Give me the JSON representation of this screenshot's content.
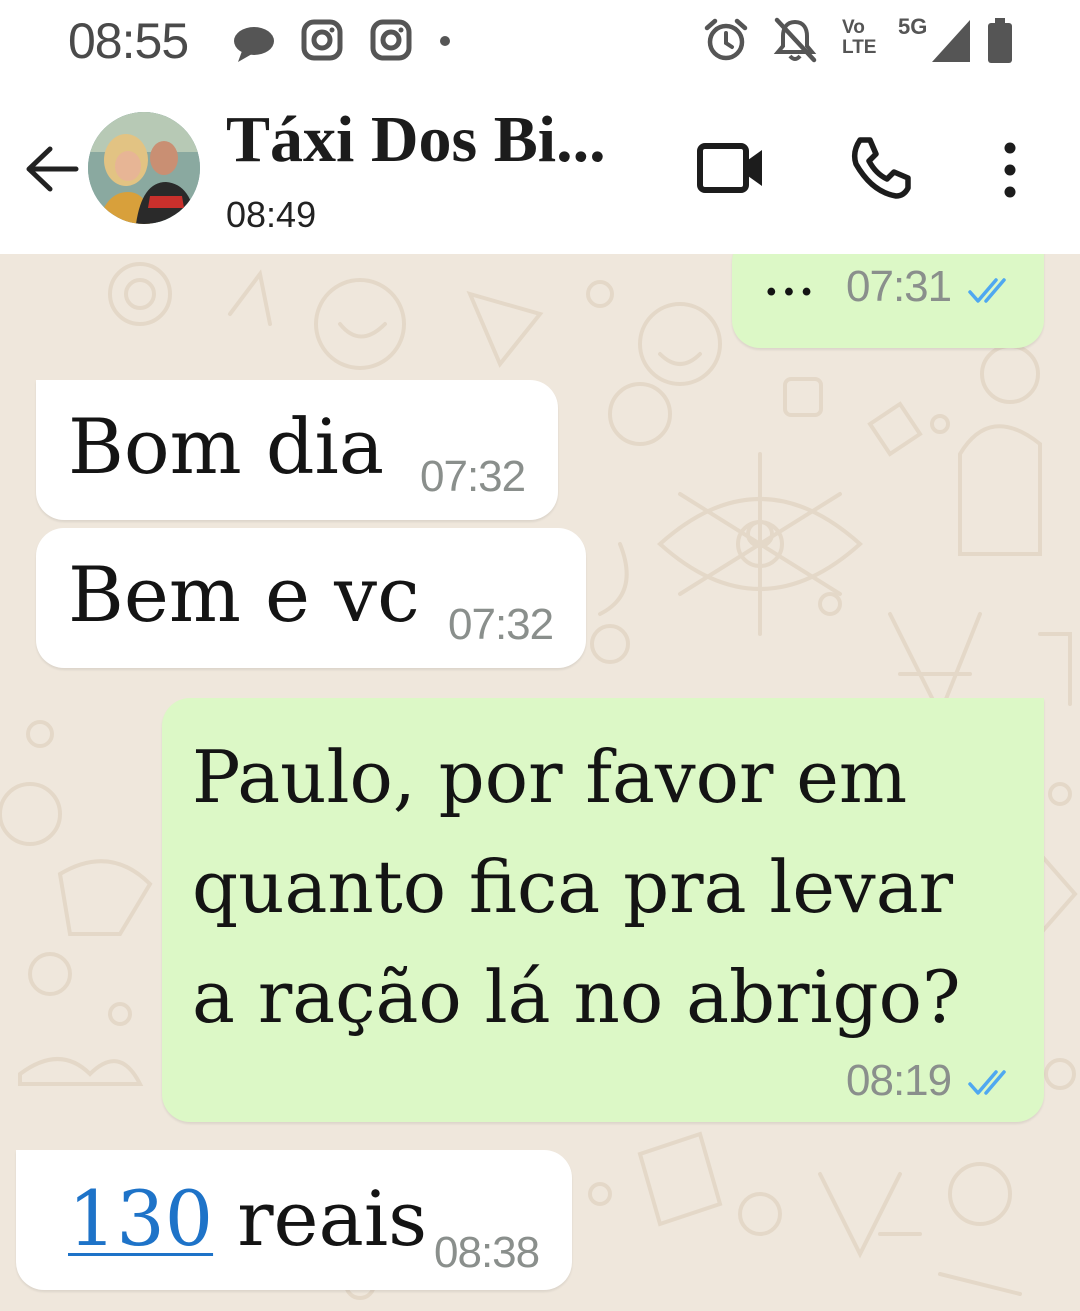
{
  "status_bar": {
    "time": "08:55",
    "network": "5G",
    "volte_top": "Vo",
    "volte_bottom": "LTE"
  },
  "header": {
    "contact_name": "Táxi Dos Bi...",
    "last_seen": "08:49"
  },
  "messages": [
    {
      "direction": "out",
      "text": "...",
      "time": "07:31",
      "status": "read"
    },
    {
      "direction": "in",
      "text": "Bom dia",
      "time": "07:32"
    },
    {
      "direction": "in",
      "text": "Bem e vc",
      "time": "07:32"
    },
    {
      "direction": "out",
      "text": "Paulo, por favor em\nquanto fica pra levar\na ração lá no abrigo?",
      "time": "08:19",
      "status": "read"
    },
    {
      "direction": "in",
      "text_link": "130",
      "text_rest": " reais",
      "time": "08:38"
    }
  ],
  "colors": {
    "outgoing_bubble": "#dcf8c6",
    "incoming_bubble": "#ffffff",
    "read_ticks": "#4fa8f0",
    "link": "#1e73c8"
  }
}
